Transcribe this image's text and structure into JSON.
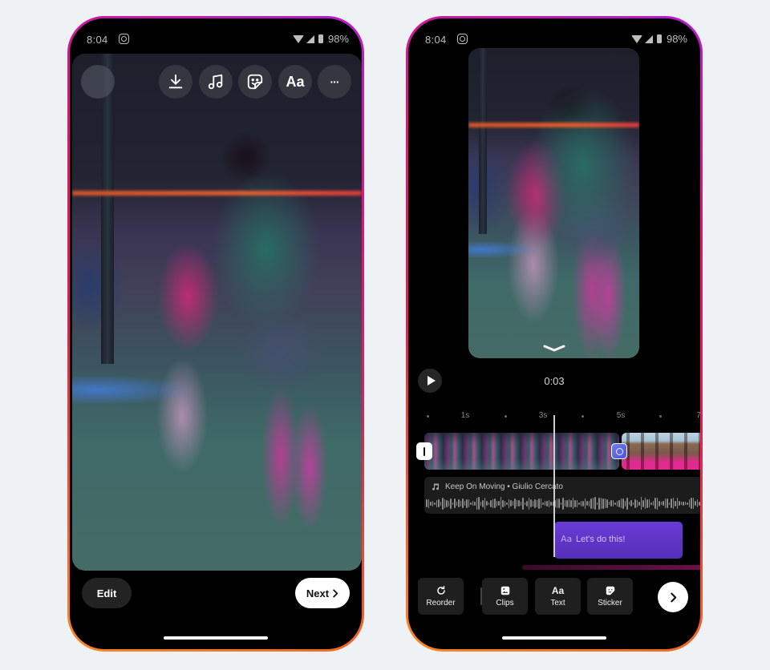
{
  "status_bar": {
    "time": "8:04",
    "battery": "98%",
    "icons": [
      "instagram-icon",
      "wifi-icon",
      "signal-icon",
      "battery-icon"
    ]
  },
  "left_screen": {
    "top_toolbar": {
      "buttons": [
        {
          "name": "download",
          "icon": "download-icon"
        },
        {
          "name": "music",
          "icon": "music-note-icon"
        },
        {
          "name": "sticker",
          "icon": "sticker-icon"
        },
        {
          "name": "text",
          "label": "Aa"
        },
        {
          "name": "more",
          "label": "···"
        }
      ]
    },
    "edit_label": "Edit",
    "next_label": "Next",
    "next_icon": "›"
  },
  "right_screen": {
    "playback_time": "0:03",
    "ruler": {
      "labels": [
        "1s",
        "3s",
        "5s",
        "7"
      ]
    },
    "audio_track": {
      "title": "Keep On Moving • Giulio Cercato"
    },
    "text_clip": {
      "icon_label": "Aa",
      "text": "Let's do this!"
    },
    "tools": [
      {
        "label": "Reorder",
        "icon": "reorder-icon"
      },
      {
        "label": "Clips",
        "icon": "clips-icon"
      },
      {
        "label": "Text",
        "icon": "Aa"
      },
      {
        "label": "Sticker",
        "icon": "sticker-icon"
      }
    ],
    "next_icon": "›"
  },
  "colors": {
    "background": "#eef2f5",
    "text_clip": "#5e34c8",
    "transition_badge": "#5a66e6",
    "frame_gradient": [
      "#b41ecb",
      "#e0166e",
      "#f58a25"
    ]
  }
}
